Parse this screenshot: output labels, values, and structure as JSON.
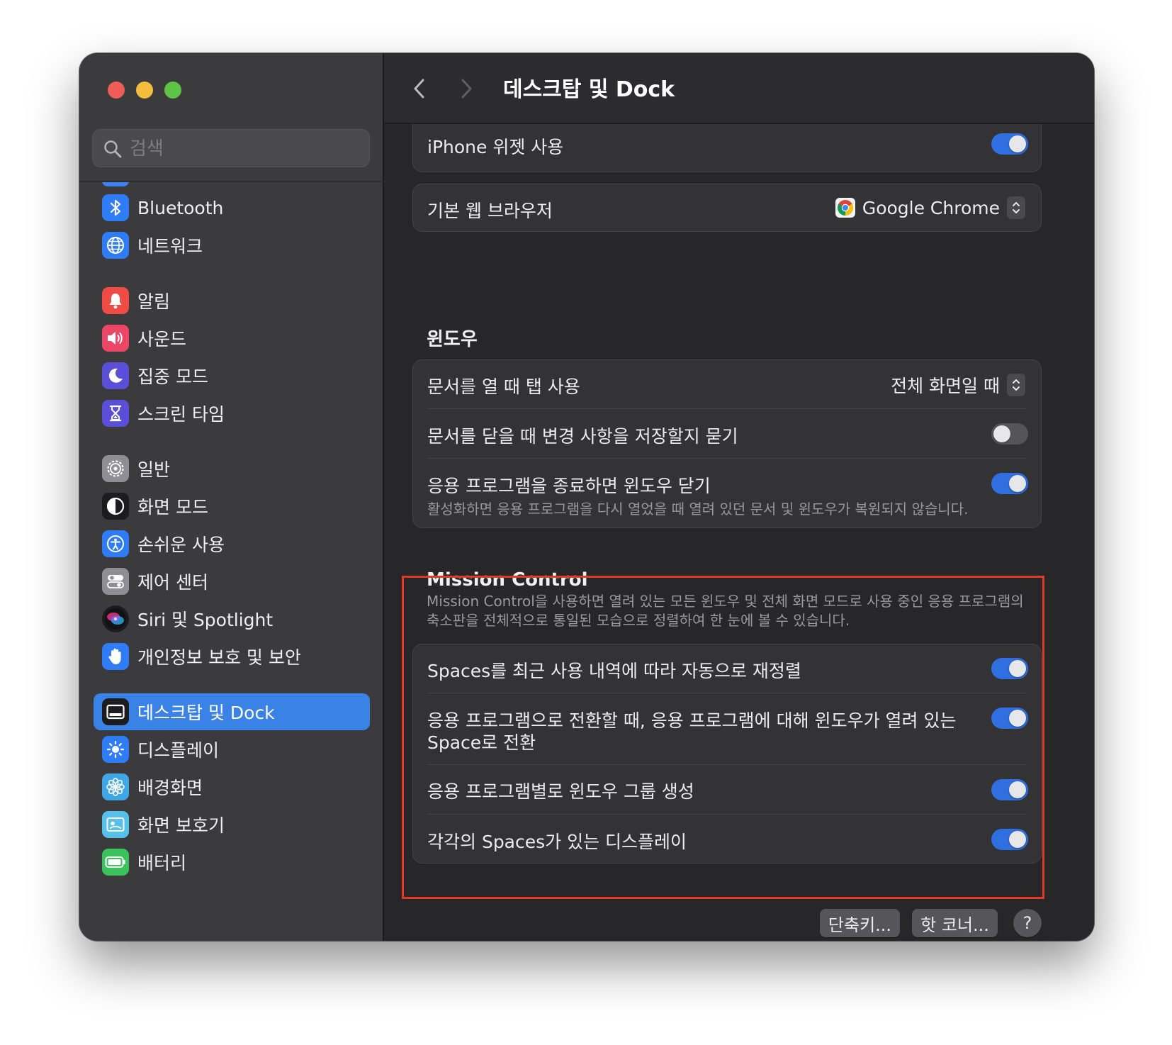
{
  "window": {
    "title": "데스크탑 및 Dock"
  },
  "search": {
    "placeholder": "검색"
  },
  "sidebar": {
    "items": [
      {
        "label": "Bluetooth",
        "icon": "bluetooth-icon",
        "color": "#2e7cf6"
      },
      {
        "label": "네트워크",
        "icon": "globe-icon",
        "color": "#2e7cf6"
      },
      {
        "label": "알림",
        "icon": "bell-icon",
        "color": "#ee4b45"
      },
      {
        "label": "사운드",
        "icon": "speaker-icon",
        "color": "#ec4667"
      },
      {
        "label": "집중 모드",
        "icon": "moon-icon",
        "color": "#5b4fd9"
      },
      {
        "label": "스크린 타임",
        "icon": "hourglass-icon",
        "color": "#5b4fd9"
      },
      {
        "label": "일반",
        "icon": "gear-icon",
        "color": "#8e8e93"
      },
      {
        "label": "화면 모드",
        "icon": "appearance-icon",
        "color": "#1c1c1e"
      },
      {
        "label": "손쉬운 사용",
        "icon": "accessibility-icon",
        "color": "#2e7cf6"
      },
      {
        "label": "제어 센터",
        "icon": "control-center-icon",
        "color": "#8e8e93"
      },
      {
        "label": "Siri 및 Spotlight",
        "icon": "siri-icon",
        "color": "#1c1c1e"
      },
      {
        "label": "개인정보 보호 및 보안",
        "icon": "hand-icon",
        "color": "#2e7cf6"
      },
      {
        "label": "데스크탑 및 Dock",
        "icon": "dock-icon",
        "color": "#1c1c1e",
        "selected": true
      },
      {
        "label": "디스플레이",
        "icon": "sun-icon",
        "color": "#2e7cf6"
      },
      {
        "label": "배경화면",
        "icon": "flower-icon",
        "color": "#3fa7e6"
      },
      {
        "label": "화면 보호기",
        "icon": "screensaver-icon",
        "color": "#56c0e8"
      },
      {
        "label": "배터리",
        "icon": "battery-icon",
        "color": "#3cc25a"
      }
    ]
  },
  "settings": {
    "iphone_widgets": {
      "label": "iPhone 위젯 사용",
      "on": true
    },
    "default_browser": {
      "label": "기본 웹 브라우저",
      "value": "Google Chrome"
    },
    "windows_section": {
      "title": "윈도우",
      "rows": [
        {
          "label": "문서를 열 때 탭 사용",
          "value": "전체 화면일 때"
        },
        {
          "label": "문서를 닫을 때 변경 사항을 저장할지 묻기",
          "on": false
        },
        {
          "label": "응용 프로그램을 종료하면 윈도우 닫기",
          "sublabel": "활성화하면 응용 프로그램을 다시 열었을 때 열려 있던 문서 및 윈도우가 복원되지 않습니다.",
          "on": true
        }
      ]
    },
    "mission_control": {
      "title": "Mission Control",
      "desc_line1": "Mission Control을 사용하면 열려 있는 모든 윈도우 및 전체 화면 모드로 사용 중인 응용 프로그램의",
      "desc_line2": "축소판을 전체적으로 통일된 모습으로 정렬하여 한 눈에 볼 수 있습니다.",
      "rows": [
        {
          "label": "Spaces를 최근 사용 내역에 따라 자동으로 재정렬",
          "on": true
        },
        {
          "label_line1": "응용 프로그램으로 전환할 때, 응용 프로그램에 대해 윈도우가 열려 있는",
          "label_line2": "Space로 전환",
          "on": true
        },
        {
          "label": "응용 프로그램별로 윈도우 그룹 생성",
          "on": true
        },
        {
          "label": "각각의 Spaces가 있는 디스플레이",
          "on": true
        }
      ]
    }
  },
  "footer": {
    "shortcuts": "단축키...",
    "hot_corners": "핫 코너...",
    "help": "?"
  },
  "highlight_color": "#e23a22",
  "accent_color": "#2f6fe0"
}
